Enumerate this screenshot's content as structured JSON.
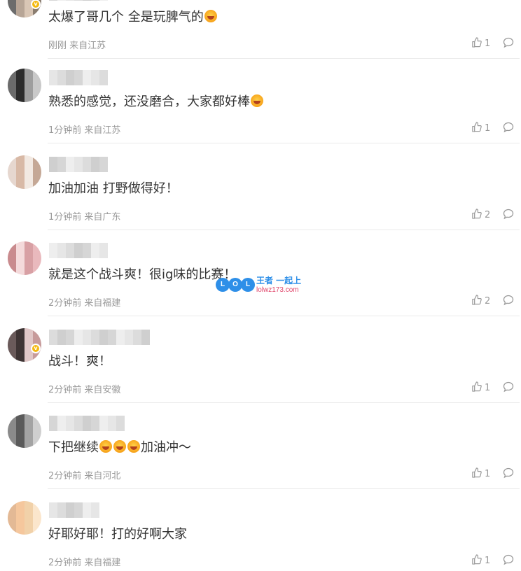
{
  "comments": [
    {
      "text": "太爆了哥几个 全是玩脾气的",
      "emoji_after": 1,
      "time": "刚刚",
      "location": "来自江苏",
      "likes": "1",
      "has_vip": true
    },
    {
      "text": "熟悉的感觉，还没磨合，大家都好棒",
      "emoji_after": 1,
      "time": "1分钟前",
      "location": "来自江苏",
      "likes": "1",
      "has_vip": false
    },
    {
      "text": "加油加油 打野做得好！",
      "emoji_after": 0,
      "time": "1分钟前",
      "location": "来自广东",
      "likes": "2",
      "has_vip": false
    },
    {
      "text": "就是这个战斗爽！很ig味的比赛！",
      "emoji_after": 0,
      "time": "2分钟前",
      "location": "来自福建",
      "likes": "2",
      "has_vip": false
    },
    {
      "text": "战斗！爽！",
      "emoji_after": 0,
      "time": "2分钟前",
      "location": "来自安徽",
      "likes": "1",
      "has_vip": true
    },
    {
      "text_before": "下把继续",
      "emoji_mid": 3,
      "text_after": "加油冲～",
      "time": "2分钟前",
      "location": "来自河北",
      "likes": "1",
      "has_vip": false
    },
    {
      "text": "好耶好耶！打的好啊大家",
      "emoji_after": 0,
      "time": "2分钟前",
      "location": "来自福建",
      "likes": "1",
      "has_vip": false
    }
  ],
  "watermark": {
    "circle_letters": [
      "L",
      "O",
      "L"
    ],
    "top_text": "王者 一起上",
    "bottom_text": "lolwz173.com"
  },
  "colors": {
    "meta_text": "#999999",
    "body_text": "#333333",
    "vip_badge": "#f5b90f",
    "watermark_blue": "#2e8fe8",
    "watermark_pink": "#e0456a"
  },
  "icons": {
    "like": "thumbs-up-icon",
    "reply": "comment-bubble-icon",
    "vip": "vip-badge-icon"
  }
}
